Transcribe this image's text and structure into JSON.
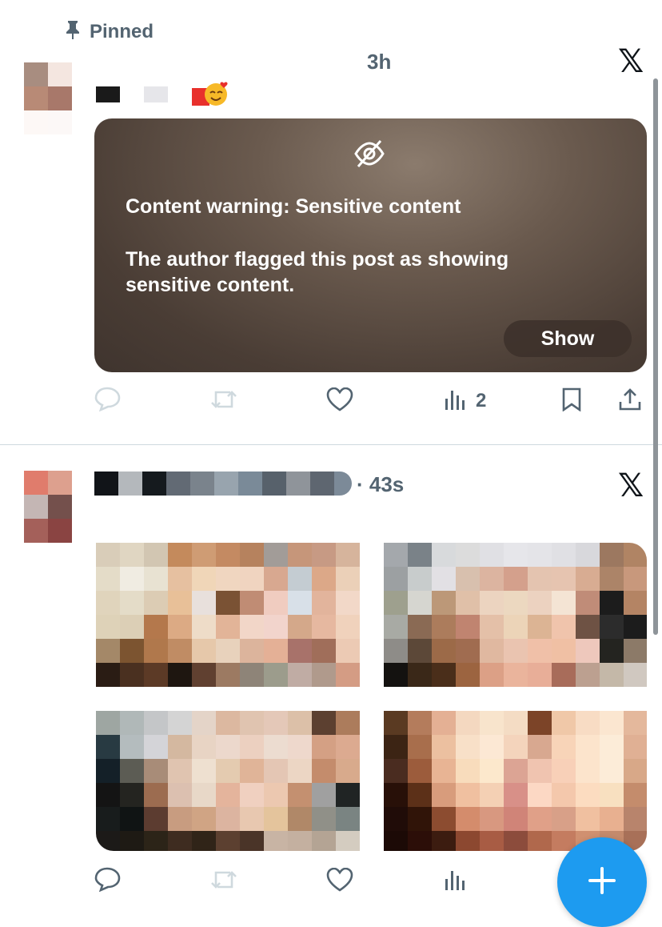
{
  "pinned": {
    "label": "Pinned",
    "icon": "pin-icon"
  },
  "post1": {
    "time": "3h",
    "warning": {
      "title": "Content warning: Sensitive content",
      "body": "The author flagged this post as showing sensitive content.",
      "show_label": "Show",
      "icon": "eye-slash-icon"
    },
    "actions": {
      "views": "2"
    }
  },
  "post2": {
    "time": "· 43s"
  },
  "fab": {
    "icon": "plus-icon"
  },
  "colors": {
    "accent": "#1d9bf0",
    "muted": "#536471",
    "divider": "#cfd9de"
  }
}
